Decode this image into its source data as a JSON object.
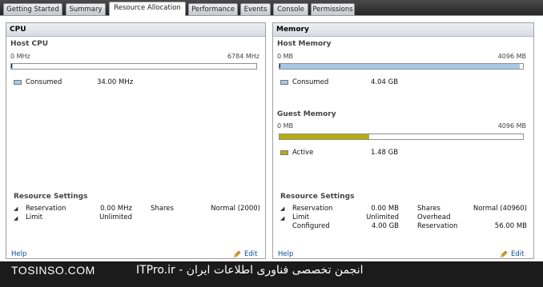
{
  "tabs": [
    {
      "label": "Getting Started"
    },
    {
      "label": "Summary"
    },
    {
      "label": "Resource Allocation",
      "active": true
    },
    {
      "label": "Performance"
    },
    {
      "label": "Events"
    },
    {
      "label": "Console"
    },
    {
      "label": "Permissions"
    }
  ],
  "cpu": {
    "title": "CPU",
    "host_cpu": {
      "label": "Host CPU",
      "min": "0 MHz",
      "max": "6784 MHz",
      "consumed_fraction": 0.005
    },
    "legend": {
      "consumed_label": "Consumed",
      "consumed_value": "34.00 MHz",
      "consumed_color": "#a7c9e6"
    },
    "resource_settings": {
      "title": "Resource Settings",
      "reservation_label": "Reservation",
      "reservation_value": "0.00 MHz",
      "limit_label": "Limit",
      "limit_value": "Unlimited",
      "shares_label": "Shares",
      "shares_value": "Normal (2000)"
    },
    "help_label": "Help",
    "edit_label": "Edit"
  },
  "memory": {
    "title": "Memory",
    "host_memory": {
      "label": "Host Memory",
      "min": "0 MB",
      "max": "4096 MB",
      "consumed_fraction": 0.987,
      "consumed_color": "#a7c9e6"
    },
    "host_legend": {
      "consumed_label": "Consumed",
      "consumed_value": "4.04 GB"
    },
    "guest_memory": {
      "label": "Guest Memory",
      "min": "0 MB",
      "max": "4096 MB",
      "active_fraction": 0.37,
      "active_color": "#b5ad10"
    },
    "guest_legend": {
      "active_label": "Active",
      "active_value": "1.48 GB"
    },
    "resource_settings": {
      "title": "Resource Settings",
      "reservation_label": "Reservation",
      "reservation_value": "0.00 MB",
      "limit_label": "Limit",
      "limit_value": "Unlimited",
      "configured_label": "Configured",
      "configured_value": "4.00 GB",
      "shares_label": "Shares",
      "shares_value": "Normal (40960)",
      "overhead_label": "Overhead",
      "overhead_reservation_label": "Reservation",
      "overhead_reservation_value": "56.00 MB"
    },
    "help_label": "Help",
    "edit_label": "Edit"
  },
  "watermark": {
    "left": "TOSINSO.COM",
    "right": "ITPro.ir - انجمن تخصصی فناوری اطلاعات ایران"
  }
}
